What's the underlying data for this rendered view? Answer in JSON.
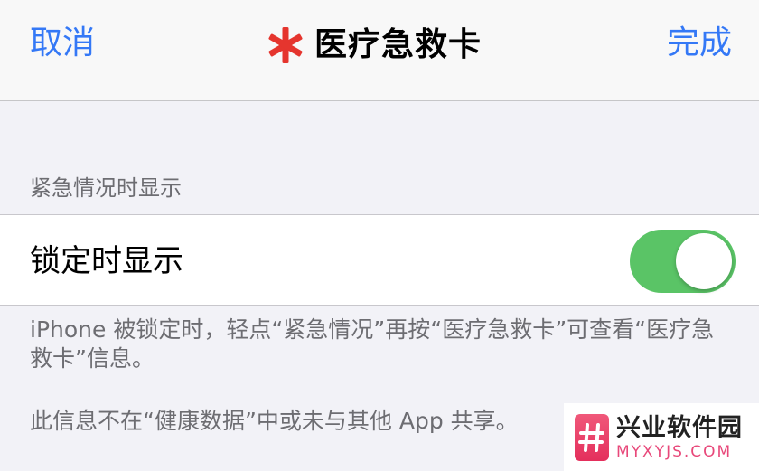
{
  "navbar": {
    "cancel_label": "取消",
    "title": "医疗急救卡",
    "done_label": "完成",
    "star_color": "#e5352e",
    "accent_color": "#3478f6"
  },
  "section": {
    "header": "紧急情况时显示",
    "cell_label": "锁定时显示",
    "toggle_on": true,
    "toggle_color": "#5ac466"
  },
  "footer": {
    "note_1": "iPhone 被锁定时，轻点“紧急情况”再按“医疗急救卡”可查看“医疗急救卡”信息。",
    "note_2": "此信息不在“健康数据”中或未与其他 App 共享。"
  },
  "watermark": {
    "name": "兴业软件园",
    "url": "MYXYJS.COM"
  }
}
